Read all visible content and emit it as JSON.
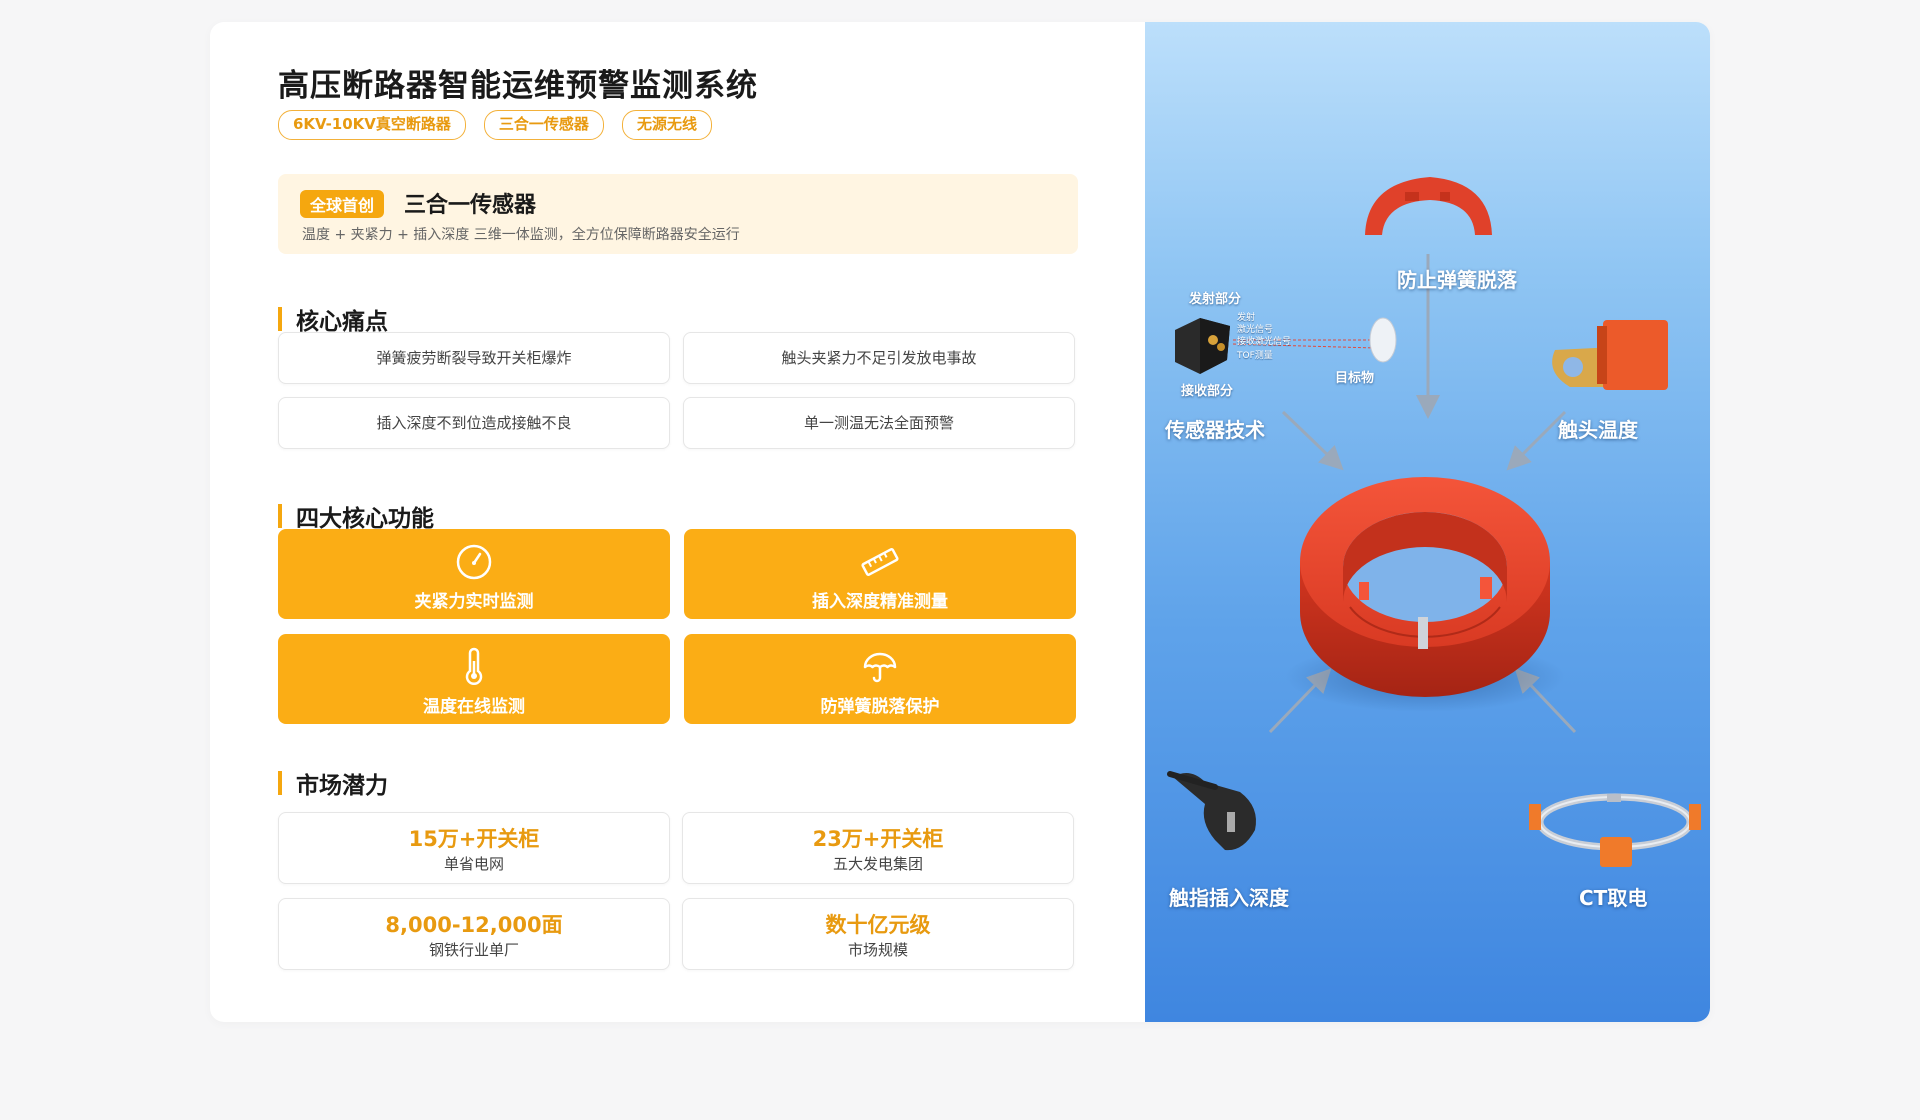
{
  "header": {
    "title": "高压断路器智能运维预警监测系统",
    "tags": [
      "6KV-10KV真空断路器",
      "三合一传感器",
      "无源无线"
    ]
  },
  "banner": {
    "badge": "全球首创",
    "title": "三合一传感器",
    "desc": "温度 + 夹紧力 + 插入深度 三维一体监测，全方位保障断路器安全运行"
  },
  "pain_points": {
    "heading": "核心痛点",
    "items": [
      "弹簧疲劳断裂导致开关柜爆炸",
      "触头夹紧力不足引发放电事故",
      "插入深度不到位造成接触不良",
      "单一测温无法全面预警"
    ]
  },
  "features": {
    "heading": "四大核心功能",
    "items": [
      {
        "label": "夹紧力实时监测",
        "icon": "gauge-icon"
      },
      {
        "label": "插入深度精准测量",
        "icon": "ruler-icon"
      },
      {
        "label": "温度在线监测",
        "icon": "thermometer-icon"
      },
      {
        "label": "防弹簧脱落保护",
        "icon": "umbrella-icon"
      }
    ]
  },
  "market": {
    "heading": "市场潜力",
    "items": [
      {
        "value": "15万+开关柜",
        "label": "单省电网"
      },
      {
        "value": "23万+开关柜",
        "label": "五大发电集团"
      },
      {
        "value": "8,000-12,000面",
        "label": "钢铁行业单厂"
      },
      {
        "value": "数十亿元级",
        "label": "市场规模"
      }
    ]
  },
  "diagram": {
    "labels": {
      "spring": "防止弹簧脱落",
      "sensor": "传感器技术",
      "contact_temp": "触头温度",
      "finger_depth": "触指插入深度",
      "ct_power": "CT取电"
    },
    "sensor_sub": {
      "emit": "发射部分",
      "receive": "接收部分",
      "target": "目标物",
      "emit_small": "发射",
      "laser_signal": "激光信号",
      "receive_laser": "接收激光信号",
      "tof": "TOF测量"
    }
  },
  "colors": {
    "accent": "#fbad15",
    "accent_text": "#e89a10",
    "ring": "#e8402a",
    "panel_blue": "#4a90e2"
  }
}
